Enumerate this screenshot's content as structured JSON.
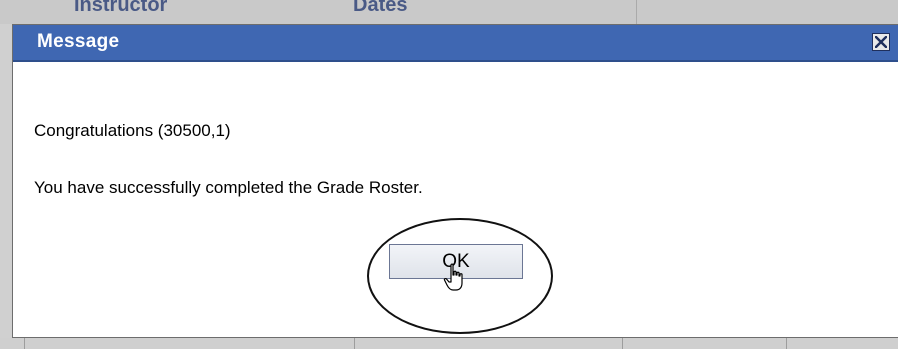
{
  "background": {
    "column_headers": [
      "Instructor",
      "Dates"
    ]
  },
  "dialog": {
    "title": "Message",
    "close_icon": "close-x-icon",
    "lines": [
      "Congratulations (30500,1)",
      "You have successfully completed the Grade Roster."
    ],
    "ok_label": "OK",
    "cursor_icon": "hand-pointer-icon"
  },
  "colors": {
    "titlebar": "#3f67b2",
    "dialog_bg": "#ffffff",
    "page_bg": "#d2d2d2"
  }
}
